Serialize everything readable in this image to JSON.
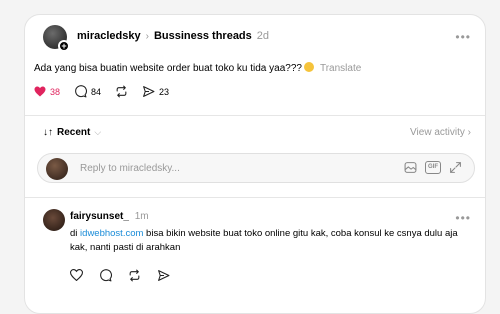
{
  "post": {
    "username": "miracledsky",
    "separator": "›",
    "thread": "Bussiness threads",
    "time": "2d",
    "more": "•••",
    "text": "Ada yang bisa buatin website order buat toko ku tida yaa???",
    "translate": "Translate",
    "likes": "38",
    "comments": "84",
    "shares": "23"
  },
  "sort": {
    "label": "Recent",
    "arrows": "↓↑"
  },
  "view_activity": "View activity ›",
  "reply": {
    "placeholder": "Reply to miracledsky..."
  },
  "comment": {
    "username": "fairysunset_",
    "time": "1m",
    "more": "•••",
    "text_before": "di ",
    "link": "idwebhost.com",
    "text_after": " bisa bikin website buat toko online gitu kak, coba konsul ke csnya dulu aja kak, nanti pasti di arahkan"
  },
  "colors": {
    "like": "#e0245e",
    "link": "#1a8cd8",
    "muted": "#999999"
  },
  "icons": [
    "plus-icon",
    "heart-filled-icon",
    "comment-icon",
    "repost-icon",
    "share-icon",
    "chevron-down-icon",
    "image-icon",
    "gif-icon",
    "expand-icon",
    "heart-icon"
  ]
}
